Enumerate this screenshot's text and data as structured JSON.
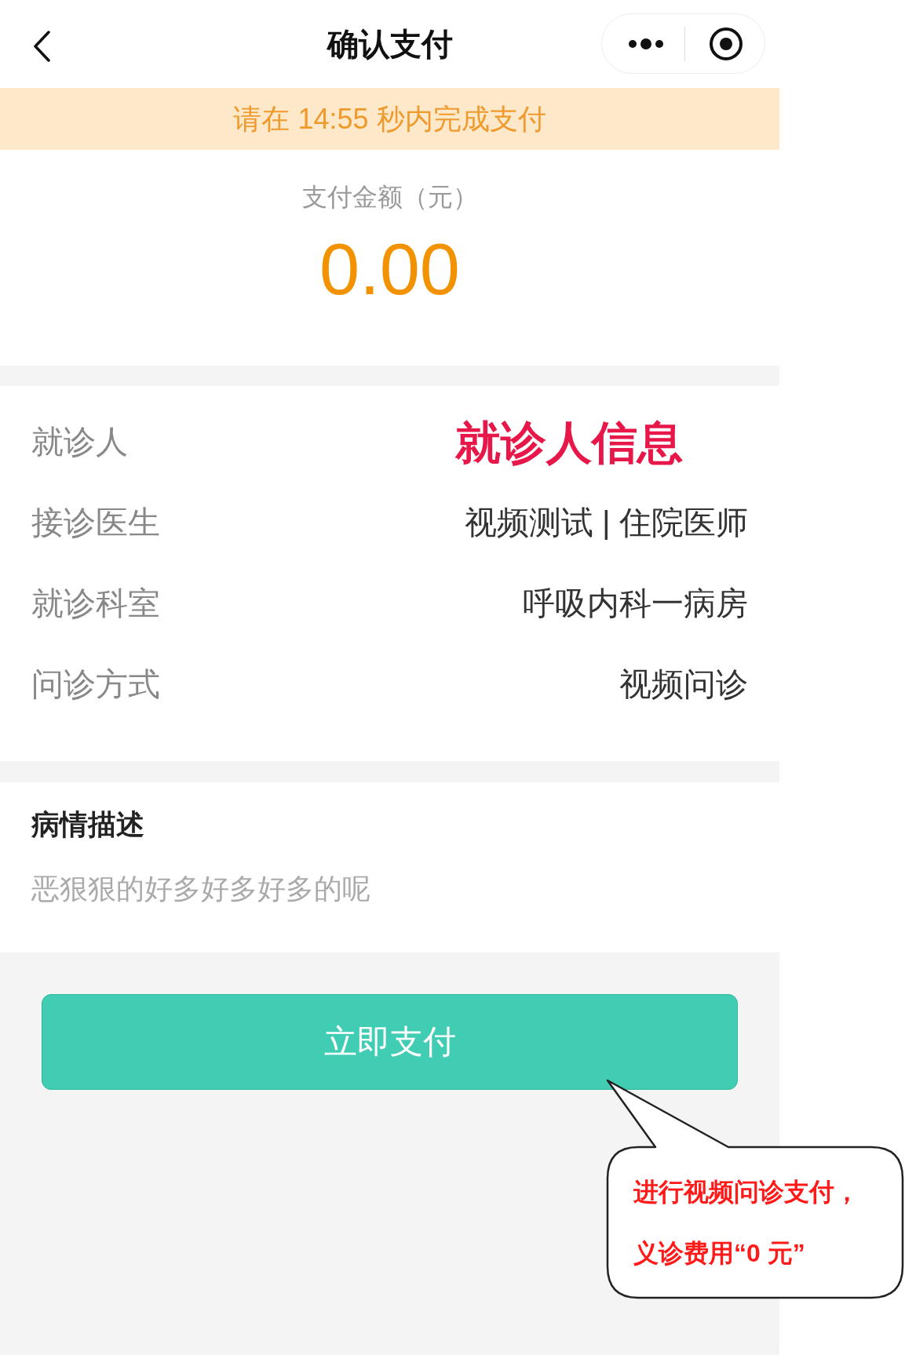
{
  "nav": {
    "title": "确认支付"
  },
  "banner": {
    "text": "请在 14:55 秒内完成支付"
  },
  "amount": {
    "label": "支付金额（元）",
    "value": "0.00"
  },
  "details": [
    {
      "kind": "annotation",
      "label": "就诊人",
      "value": "就诊人信息"
    },
    {
      "kind": "text",
      "label": "接诊医生",
      "value": "视频测试 | 住院医师"
    },
    {
      "kind": "text",
      "label": "就诊科室",
      "value": "呼吸内科一病房"
    },
    {
      "kind": "text",
      "label": "问诊方式",
      "value": "视频问诊"
    }
  ],
  "description": {
    "title": "病情描述",
    "text": "恶狠狠的好多好多好多的呢"
  },
  "pay_button": {
    "label": "立即支付"
  },
  "callout": {
    "lines": [
      "进行视频问诊支付，",
      "义诊费用“0 元”"
    ]
  }
}
